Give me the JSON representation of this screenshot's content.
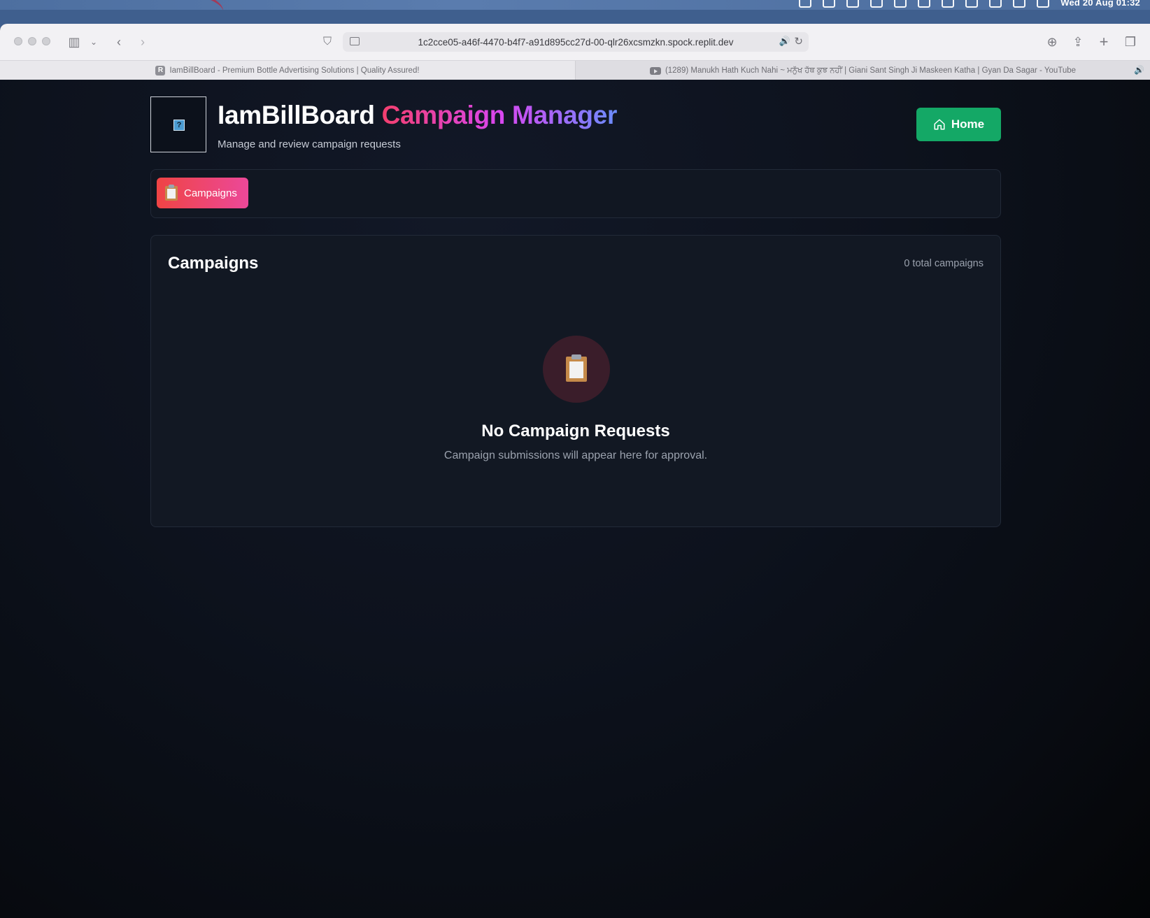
{
  "menubar": {
    "clock": "Wed 20 Aug  01:32",
    "tray_icons": [
      "mail-icon",
      "word-icon",
      "wifi-icon",
      "piano-icon",
      "volume-icon",
      "play-icon",
      "screen-icon",
      "cloud-icon",
      "search-icon",
      "control-center-icon",
      "siri-icon"
    ]
  },
  "browser": {
    "url": "1c2cce05-a46f-4470-b4f7-a91d895cc27d-00-qlr26xcsmzkn.spock.replit.dev",
    "tabs": [
      {
        "favicon": "R",
        "title": "IamBillBoard - Premium Bottle Advertising Solutions | Quality Assured!"
      },
      {
        "title": "(1289) Manukh Hath Kuch Nahi ~ ਮਨੁੱਖ ਹੱਥ ਕੁਝ ਨਹੀਂ | Giani Sant Singh Ji Maskeen Katha | Gyan Da Sagar - YouTube"
      }
    ]
  },
  "header": {
    "logo_glyph": "?",
    "title_plain": "IamBillBoard ",
    "title_gradient": "Campaign Manager",
    "subtitle": "Manage and review campaign requests",
    "home_label": "Home"
  },
  "nav": {
    "campaigns_label": "Campaigns"
  },
  "campaigns_card": {
    "title": "Campaigns",
    "count_text": "0 total campaigns",
    "empty_title": "No Campaign Requests",
    "empty_text": "Campaign submissions will appear here for approval."
  },
  "colors": {
    "home_button": "#14a866",
    "tab_gradient_start": "#ef4444",
    "tab_gradient_end": "#ec4899",
    "background": "#0d121d"
  }
}
